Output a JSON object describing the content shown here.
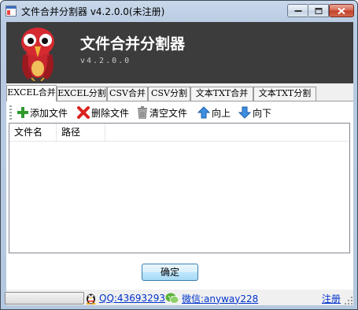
{
  "window": {
    "title": "文件合并分割器 v4.2.0.0(未注册)"
  },
  "banner": {
    "title": "文件合并分割器",
    "version": "v4.2.0.0"
  },
  "tabs": [
    {
      "label": "EXCEL合并",
      "active": true
    },
    {
      "label": "EXCEL分割",
      "active": false
    },
    {
      "label": "CSV合并",
      "active": false
    },
    {
      "label": "CSV分割",
      "active": false
    },
    {
      "label": "文本TXT合并",
      "active": false
    },
    {
      "label": "文本TXT分割",
      "active": false
    }
  ],
  "toolbar": {
    "add_label": "添加文件",
    "delete_label": "删除文件",
    "clear_label": "清空文件",
    "up_label": "向上",
    "down_label": "向下"
  },
  "table": {
    "columns": [
      "文件名",
      "路径"
    ],
    "rows": []
  },
  "ok_button": {
    "label": "确定"
  },
  "statusbar": {
    "progress": 0,
    "qq": "QQ:43693293",
    "wechat": "微信:anyway228",
    "register": "注册"
  },
  "icons": {
    "add": "plus-icon",
    "delete": "red-x-icon",
    "clear": "trash-icon",
    "up": "arrow-up-icon",
    "down": "arrow-down-icon",
    "qq": "qq-penguin-icon",
    "wechat": "wechat-icon"
  },
  "colors": {
    "banner_bg": "#3c3c3c",
    "link": "#0033cc",
    "close_button": "#c13f26"
  }
}
